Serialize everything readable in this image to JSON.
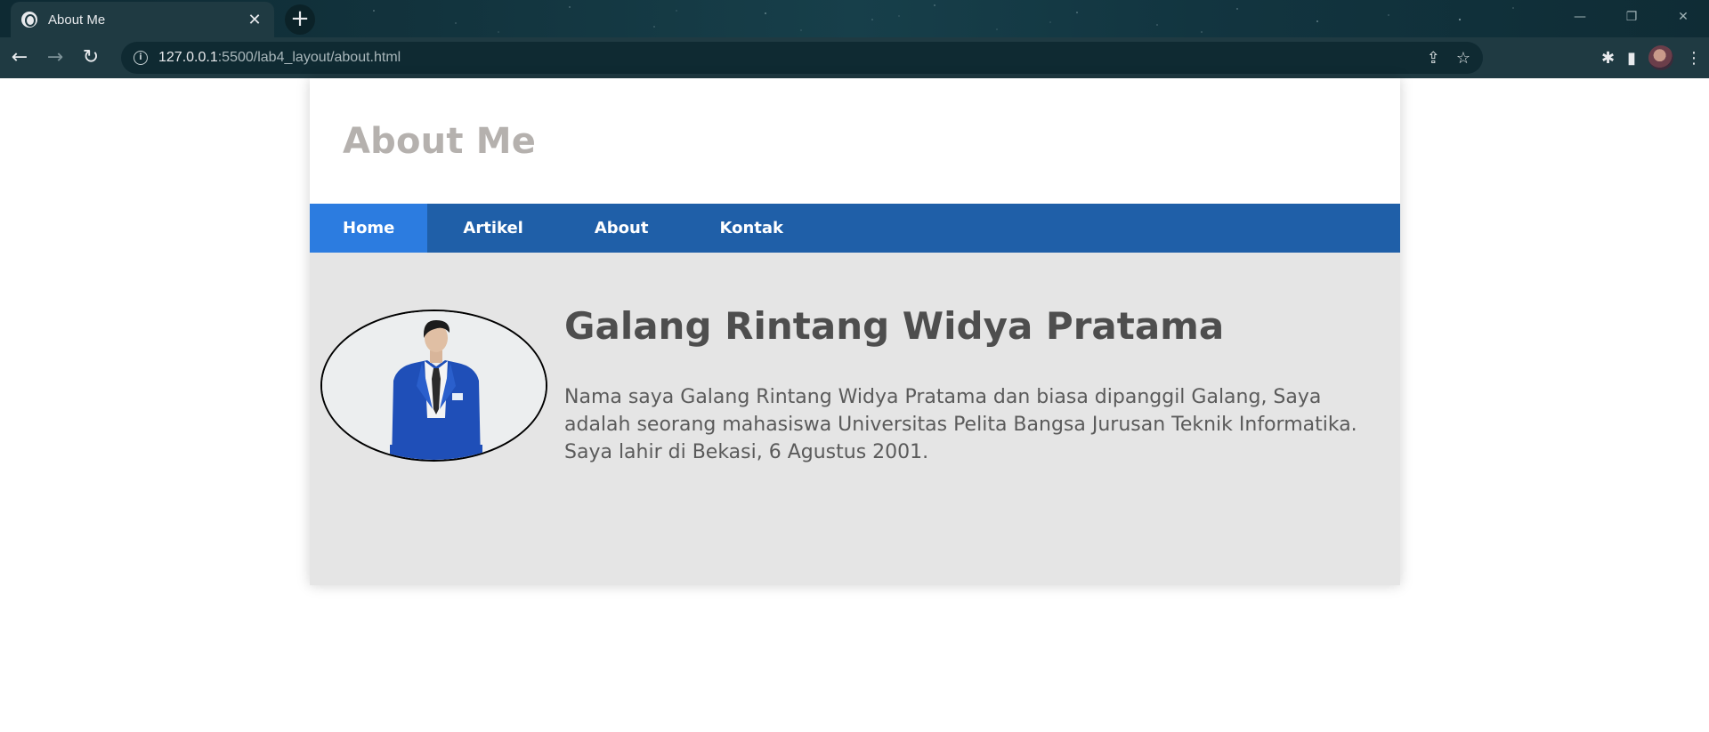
{
  "browser": {
    "tab_title": "About Me",
    "tab_close": "✕",
    "new_tab": "+",
    "back": "←",
    "forward": "→",
    "reload": "↻",
    "url_host": "127.0.0.1",
    "url_rest": ":5500/lab4_layout/about.html",
    "win_minimize": "—",
    "win_restore": "❐",
    "win_close": "✕",
    "share_icon": "⇪",
    "star_icon": "☆",
    "extensions_icon": "✱",
    "sidepanel_icon": "▮",
    "menu_icon": "⋮"
  },
  "page": {
    "header_title": "About Me",
    "nav": [
      {
        "label": "Home",
        "active": true
      },
      {
        "label": "Artikel",
        "active": false
      },
      {
        "label": "About",
        "active": false
      },
      {
        "label": "Kontak",
        "active": false
      }
    ],
    "name": "Galang Rintang Widya Pratama",
    "bio": "Nama saya Galang Rintang Widya Pratama dan biasa dipanggil Galang, Saya adalah seorang mahasiswa Universitas Pelita Bangsa Jurusan Teknik Informatika. Saya lahir di Bekasi, 6 Agustus 2001."
  },
  "colors": {
    "nav_bg": "#1f5fa8",
    "nav_active": "#2c7ce0",
    "content_bg": "#e5e5e5",
    "title_gray": "#b5b1ae",
    "jacket_blue": "#1f4fb8"
  }
}
